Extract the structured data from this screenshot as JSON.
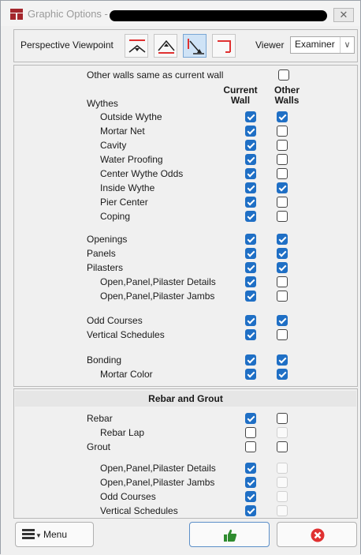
{
  "window": {
    "title": "Graphic Options -",
    "close_glyph": "✕"
  },
  "toolbar": {
    "perspective_label": "Perspective Viewpoint",
    "viewpoints": [
      "viewpoint-front",
      "viewpoint-top",
      "viewpoint-diagonal",
      "viewpoint-corner"
    ],
    "active_viewpoint": "viewpoint-diagonal",
    "viewer_label": "Viewer",
    "viewer_value": "Examiner"
  },
  "walls": {
    "same_label": "Other walls same as current wall",
    "same_checked": false,
    "col_current": "Current\nWall",
    "col_other": "Other\nWalls",
    "wythes_label": "Wythes",
    "wythes": [
      {
        "label": "Outside Wythe",
        "current": true,
        "other": true
      },
      {
        "label": "Mortar Net",
        "current": true,
        "other": false
      },
      {
        "label": "Cavity",
        "current": true,
        "other": false
      },
      {
        "label": "Water Proofing",
        "current": true,
        "other": false
      },
      {
        "label": "Center Wythe Odds",
        "current": true,
        "other": false
      },
      {
        "label": "Inside Wythe",
        "current": true,
        "other": true
      },
      {
        "label": "Pier Center",
        "current": true,
        "other": false
      },
      {
        "label": "Coping",
        "current": true,
        "other": false
      }
    ],
    "group2": [
      {
        "label": "Openings",
        "current": true,
        "other": true
      },
      {
        "label": "Panels",
        "current": true,
        "other": true
      },
      {
        "label": "Pilasters",
        "current": true,
        "other": true
      },
      {
        "label": "Open,Panel,Pilaster Details",
        "current": true,
        "other": false
      },
      {
        "label": "Open,Panel,Pilaster Jambs",
        "current": true,
        "other": false
      }
    ],
    "group3": [
      {
        "label": "Odd Courses",
        "current": true,
        "other": true
      },
      {
        "label": "Vertical Schedules",
        "current": true,
        "other": false
      }
    ],
    "group4": [
      {
        "label": "Bonding",
        "current": true,
        "other": true
      },
      {
        "label": "Mortar Color",
        "current": true,
        "other": true
      }
    ]
  },
  "rebar": {
    "header": "Rebar and Grout",
    "rows": [
      {
        "label": "Rebar",
        "current": true,
        "other": false,
        "other_disabled": false
      },
      {
        "label": "Rebar Lap",
        "current": false,
        "other": false,
        "other_disabled": true
      },
      {
        "label": "Grout",
        "current": false,
        "other": false,
        "other_disabled": false
      },
      {
        "label": "Open,Panel,Pilaster Details",
        "current": true,
        "other": false,
        "other_disabled": true
      },
      {
        "label": "Open,Panel,Pilaster Jambs",
        "current": true,
        "other": false,
        "other_disabled": true
      },
      {
        "label": "Odd Courses",
        "current": true,
        "other": false,
        "other_disabled": true
      },
      {
        "label": "Vertical Schedules",
        "current": true,
        "other": false,
        "other_disabled": true
      }
    ]
  },
  "footer": {
    "menu_label": "Menu"
  },
  "colors": {
    "accent": "#1f6fc5",
    "brand": "#a4262c",
    "ok": "#2e8b2e",
    "cancel": "#e03131"
  }
}
